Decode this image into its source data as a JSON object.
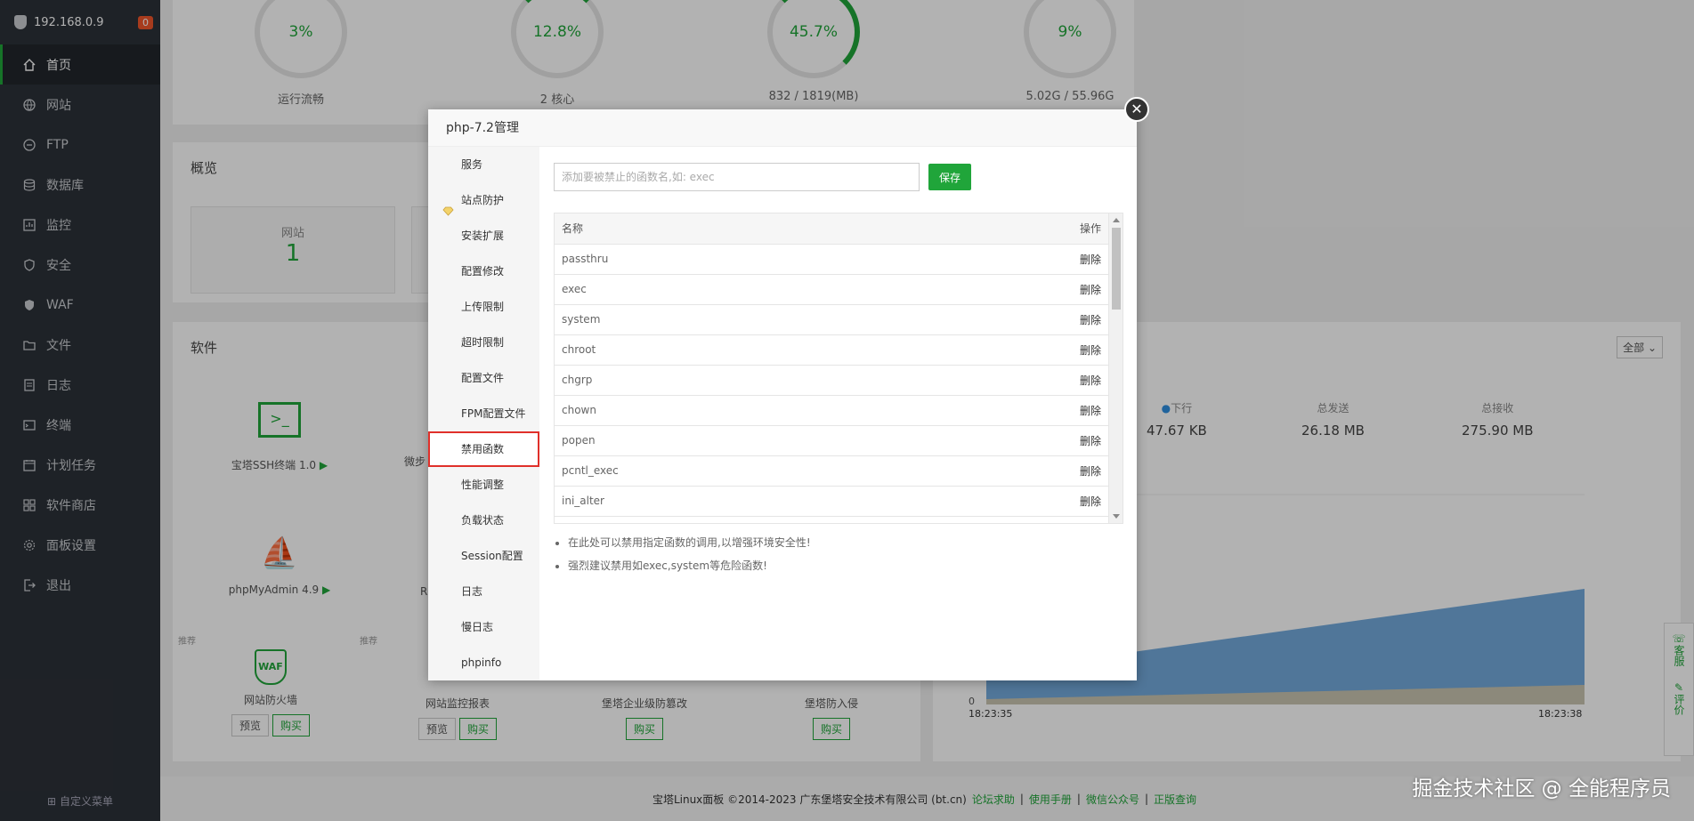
{
  "sidebar": {
    "ip": "192.168.0.9",
    "badge": "0",
    "items": [
      {
        "label": "首页",
        "icon": "home-icon"
      },
      {
        "label": "网站",
        "icon": "globe-icon"
      },
      {
        "label": "FTP",
        "icon": "ftp-icon"
      },
      {
        "label": "数据库",
        "icon": "database-icon"
      },
      {
        "label": "监控",
        "icon": "monitor-icon"
      },
      {
        "label": "安全",
        "icon": "shield-icon"
      },
      {
        "label": "WAF",
        "icon": "waf-icon"
      },
      {
        "label": "文件",
        "icon": "folder-icon"
      },
      {
        "label": "日志",
        "icon": "log-icon"
      },
      {
        "label": "终端",
        "icon": "terminal-icon"
      },
      {
        "label": "计划任务",
        "icon": "calendar-icon"
      },
      {
        "label": "软件商店",
        "icon": "apps-icon"
      },
      {
        "label": "面板设置",
        "icon": "gear-icon"
      },
      {
        "label": "退出",
        "icon": "logout-icon"
      }
    ],
    "custom_menu": "自定义菜单"
  },
  "status": {
    "gauges": [
      {
        "value": "3%",
        "label": "运行流畅"
      },
      {
        "value": "12.8%",
        "label": "2 核心"
      },
      {
        "value": "45.7%",
        "label": "832 / 1819(MB)"
      },
      {
        "value": "9%",
        "label": "5.02G / 55.96G"
      }
    ]
  },
  "overview": {
    "title": "概览",
    "site_label": "网站",
    "site_count": "1"
  },
  "software": {
    "title": "软件",
    "filter": "全部",
    "ssh": "宝塔SSH终端 1.0",
    "ssh_partial": "微步",
    "pma": "phpMyAdmin 4.9",
    "pma_partial": "R",
    "recommend": "推荐",
    "waf_name": "网站防火墙",
    "monitor_name": "网站监控报表",
    "tamper_name": "堡塔企业级防篡改",
    "intrusion_name": "堡塔防入侵",
    "preview": "预览",
    "buy": "购买"
  },
  "network": {
    "down_label": "下行",
    "down_value": "47.67 KB",
    "sent_label": "总发送",
    "sent_value": "26.18 MB",
    "recv_label": "总接收",
    "recv_value": "275.90 MB",
    "y_zero": "0",
    "t_start": "18:23:35",
    "t_end": "18:23:38"
  },
  "modal": {
    "title": "php-7.2管理",
    "nav": [
      "服务",
      "站点防护",
      "安装扩展",
      "配置修改",
      "上传限制",
      "超时限制",
      "配置文件",
      "FPM配置文件",
      "禁用函数",
      "性能调整",
      "负载状态",
      "Session配置",
      "日志",
      "慢日志",
      "phpinfo"
    ],
    "input_placeholder": "添加要被禁止的函数名,如: exec",
    "save": "保存",
    "col_name": "名称",
    "col_op": "操作",
    "rows": [
      {
        "name": "passthru",
        "op": "删除"
      },
      {
        "name": "exec",
        "op": "删除"
      },
      {
        "name": "system",
        "op": "删除"
      },
      {
        "name": "chroot",
        "op": "删除"
      },
      {
        "name": "chgrp",
        "op": "删除"
      },
      {
        "name": "chown",
        "op": "删除"
      },
      {
        "name": "popen",
        "op": "删除"
      },
      {
        "name": "pcntl_exec",
        "op": "删除"
      },
      {
        "name": "ini_alter",
        "op": "删除"
      }
    ],
    "notes": [
      "在此处可以禁用指定函数的调用,以增强环境安全性!",
      "强烈建议禁用如exec,system等危险函数!"
    ]
  },
  "footer": {
    "copyright": "宝塔Linux面板 ©2014-2023 广东堡塔安全技术有限公司 (bt.cn)",
    "links": [
      "论坛求助",
      "使用手册",
      "微信公众号",
      "正版查询"
    ]
  },
  "float": {
    "service": "客服",
    "review": "评价"
  },
  "watermark": "掘金技术社区 @ 全能程序员"
}
